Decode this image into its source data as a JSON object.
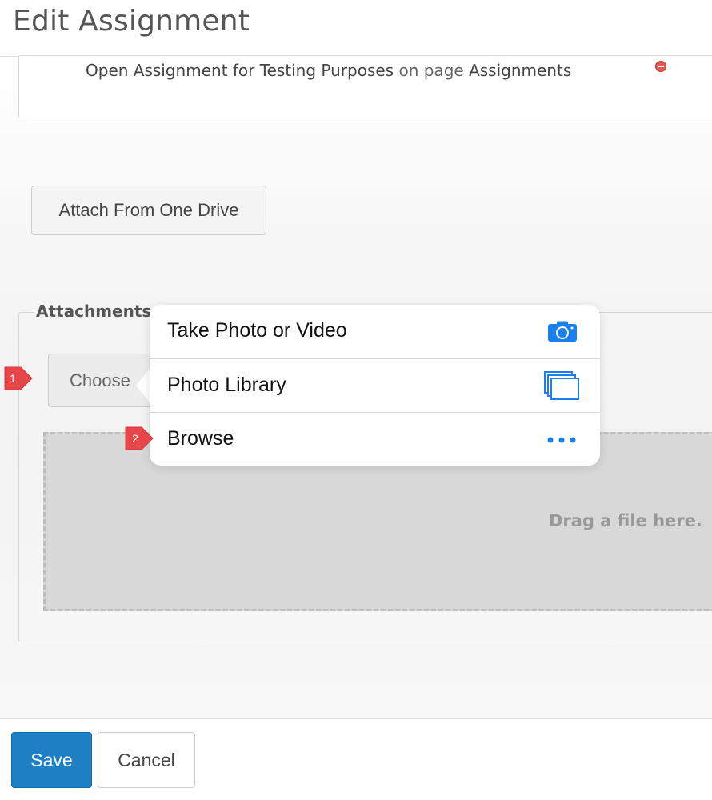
{
  "header": {
    "title": "Edit Assignment"
  },
  "linked_item": {
    "name": "Open Assignment for Testing Purposes",
    "connector": "on page",
    "page": "Assignments"
  },
  "buttons": {
    "attach_onedrive": "Attach From One Drive",
    "choose": "Choose",
    "save": "Save",
    "cancel": "Cancel"
  },
  "attachments": {
    "legend": "Attachments",
    "drop_text": "Drag a file here."
  },
  "popover": {
    "items": [
      {
        "label": "Take Photo or Video",
        "icon": "camera-icon"
      },
      {
        "label": "Photo Library",
        "icon": "photo-library-icon"
      },
      {
        "label": "Browse",
        "icon": "more-icon"
      }
    ]
  },
  "callouts": [
    "1",
    "2"
  ],
  "colors": {
    "accent": "#1e7fc4",
    "ios_blue": "#1a7ff0",
    "callout_red": "#e8474a"
  }
}
